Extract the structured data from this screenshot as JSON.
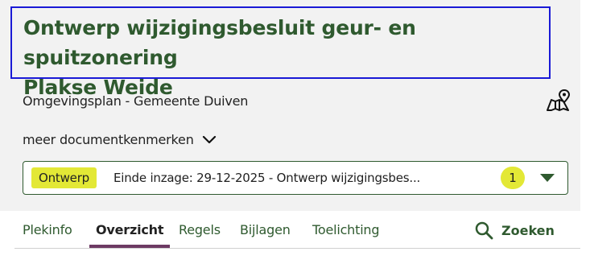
{
  "document": {
    "title_line1": "Ontwerp wijzigingsbesluit geur- en spuitzonering",
    "title_line2": "Plakse Weide",
    "subtitle": "Omgevingsplan - Gemeente Duiven",
    "more_label": "meer documentkenmerken"
  },
  "version": {
    "badge": "Ontwerp",
    "text": "Einde inzage: 29-12-2025 - Ontwerp wijzigingsbes...",
    "count": "1"
  },
  "tabs": [
    {
      "label": "Plekinfo"
    },
    {
      "label": "Overzicht"
    },
    {
      "label": "Regels"
    },
    {
      "label": "Bijlagen"
    },
    {
      "label": "Toelichting"
    }
  ],
  "search": {
    "label": "Zoeken"
  },
  "colors": {
    "title": "#2f5a2f",
    "badge": "#e3e836",
    "active_tab": "#6d3a63",
    "focus_border": "#1a1ad6"
  },
  "icons": {
    "map": "map-pin-icon",
    "more": "chevron-down-icon",
    "dropdown": "caret-down-icon",
    "search": "search-icon"
  }
}
